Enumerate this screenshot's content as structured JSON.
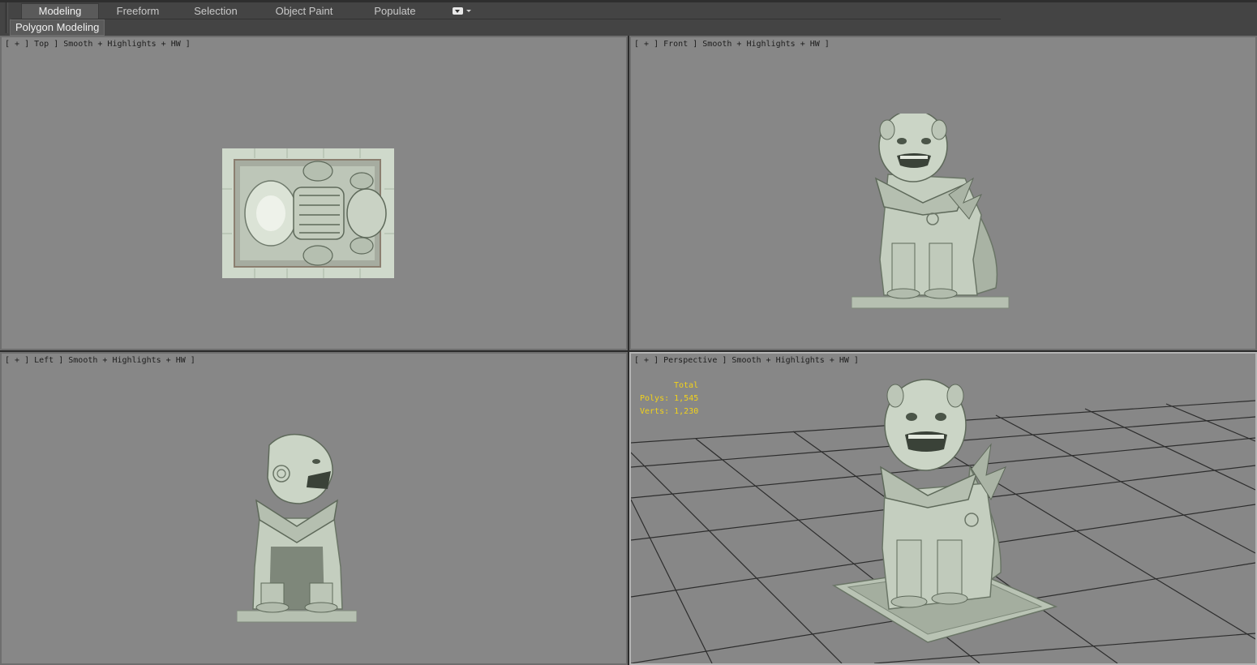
{
  "ribbon": {
    "tabs": [
      {
        "label": "Modeling",
        "active": true
      },
      {
        "label": "Freeform"
      },
      {
        "label": "Selection"
      },
      {
        "label": "Object Paint"
      },
      {
        "label": "Populate"
      }
    ],
    "panel_label": "Polygon Modeling"
  },
  "viewports": {
    "top": {
      "label": "[ + ] Top ] Smooth + Highlights + HW ]"
    },
    "front": {
      "label": "[ + ] Front ] Smooth + Highlights + HW ]"
    },
    "left": {
      "label": "[ + ] Left ] Smooth + Highlights + HW ]"
    },
    "perspective": {
      "label": "[ + ] Perspective ] Smooth + Highlights + HW ]",
      "stats": {
        "title": "Total",
        "polys": "Polys: 1,545",
        "verts": "Verts: 1,230"
      }
    }
  },
  "colors": {
    "viewport_bg": "#878787",
    "stone": "#c9d3c4",
    "stats_text": "#f2d21a"
  },
  "icons": {
    "workspace_dropdown": "dropdown-box-icon"
  }
}
